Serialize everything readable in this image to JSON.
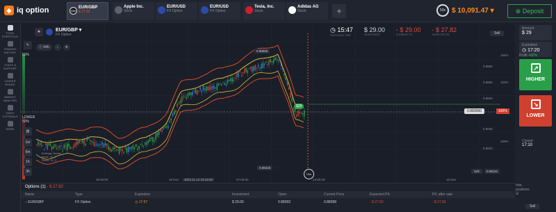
{
  "app": {
    "logo_text": "iq option"
  },
  "tabs": [
    {
      "name": "EUR/GBP",
      "sub": "$ 27.82",
      "sub_neg": true,
      "timer": "15m"
    },
    {
      "name": "Apple Inc.",
      "sub": "Stock"
    },
    {
      "name": "EUR/USD",
      "sub": "FX Option"
    },
    {
      "name": "EUR/USD",
      "sub": "FX Option"
    },
    {
      "name": "Tesla, Inc.",
      "sub": "Stock"
    },
    {
      "name": "Adidas AG",
      "sub": "Stock"
    }
  ],
  "header": {
    "add_tab": "+",
    "timer_ring": "50s",
    "balance": "$ 10,091.47",
    "deposit": "Deposit"
  },
  "leftnav": [
    {
      "label": "TOTAL PORTFOLIO"
    },
    {
      "label": "TRADING HISTORY"
    },
    {
      "label": "CHATS & SUPPORT"
    },
    {
      "label": "LEADER BOARD"
    },
    {
      "label": "MARKET ANALYSIS"
    },
    {
      "label": "VIDEO TUTORIALS"
    },
    {
      "label": "MORE"
    }
  ],
  "chart_header": {
    "asset": "EUR/GBP",
    "asset_type": "FX Option",
    "info_label": "Info",
    "time": "15:47",
    "time_label": "PURCHASE TIME",
    "investment": "$ 29.00",
    "investment_label": "INVESTMENT",
    "current_pnl": "- $ 29.00",
    "current_pnl_label": "CURRENT P/L",
    "expected_pnl": "- $ 27.82",
    "expected_pnl_label": "EXPECTED P/L"
  },
  "chart_labels": {
    "higher_pct": "50%",
    "lower_label": "LOWER",
    "lower_pct": "50%",
    "high_price": "0.88555",
    "low_price": "0.88425",
    "deal_badge": "$29",
    "current_price": "0.883580",
    "current_pct": "100%",
    "sell_price": "0.88224",
    "sell_label": "Sell",
    "expiry_badge": "15m",
    "time_ticks": [
      "19:00:00",
      "15 Nov",
      "2023.11.14 23:15:00",
      "07:00:00",
      "13:00:00",
      "15 Nov"
    ],
    "price_ticks": [
      "0.8860",
      "0.8850",
      "0.8840",
      "0.8830",
      "0.8820"
    ],
    "pct_ticks": [
      "155%",
      "120%",
      "100%"
    ],
    "indicator_lines": [
      "Bollinger Bands",
      "Band: 20, 2",
      "Stoch: 14, 3"
    ],
    "timeframes": [
      "1m",
      "5m",
      "1h",
      "3h"
    ]
  },
  "rightpanel": {
    "amount_label": "Amount",
    "amount_value": "$ 29",
    "expiration_label": "Expiration",
    "expiration_value": "17:20",
    "profit_label": "Profit",
    "profit_value": "+82%",
    "higher_label": "HIGHER",
    "lower_label": "LOWER",
    "closed_label": "Closed",
    "closed_value": "17:10"
  },
  "bottom": {
    "title": "Options (1)",
    "title_pnl": "- $ 27.82",
    "history_btn": "Hist positions",
    "columns": [
      "Name",
      "Type",
      "Expiration",
      "Investment",
      "Open",
      "Current Price",
      "Expected P/L",
      "P/L after sale"
    ],
    "row": {
      "name": "EUR/GBP",
      "type": "FX Option",
      "expiration": "17:57",
      "investment": "$ 29.00",
      "open": "0.88393",
      "current": "0.88358",
      "expected": "- $ 27.82",
      "after_sale": "- $ 27.82",
      "action": "Sell"
    }
  },
  "colors": {
    "up": "#2aa34a",
    "down": "#d0402f",
    "accent": "#ff8a1a",
    "band_red": "#d94a2a",
    "band_yellow": "#d8b93a"
  }
}
